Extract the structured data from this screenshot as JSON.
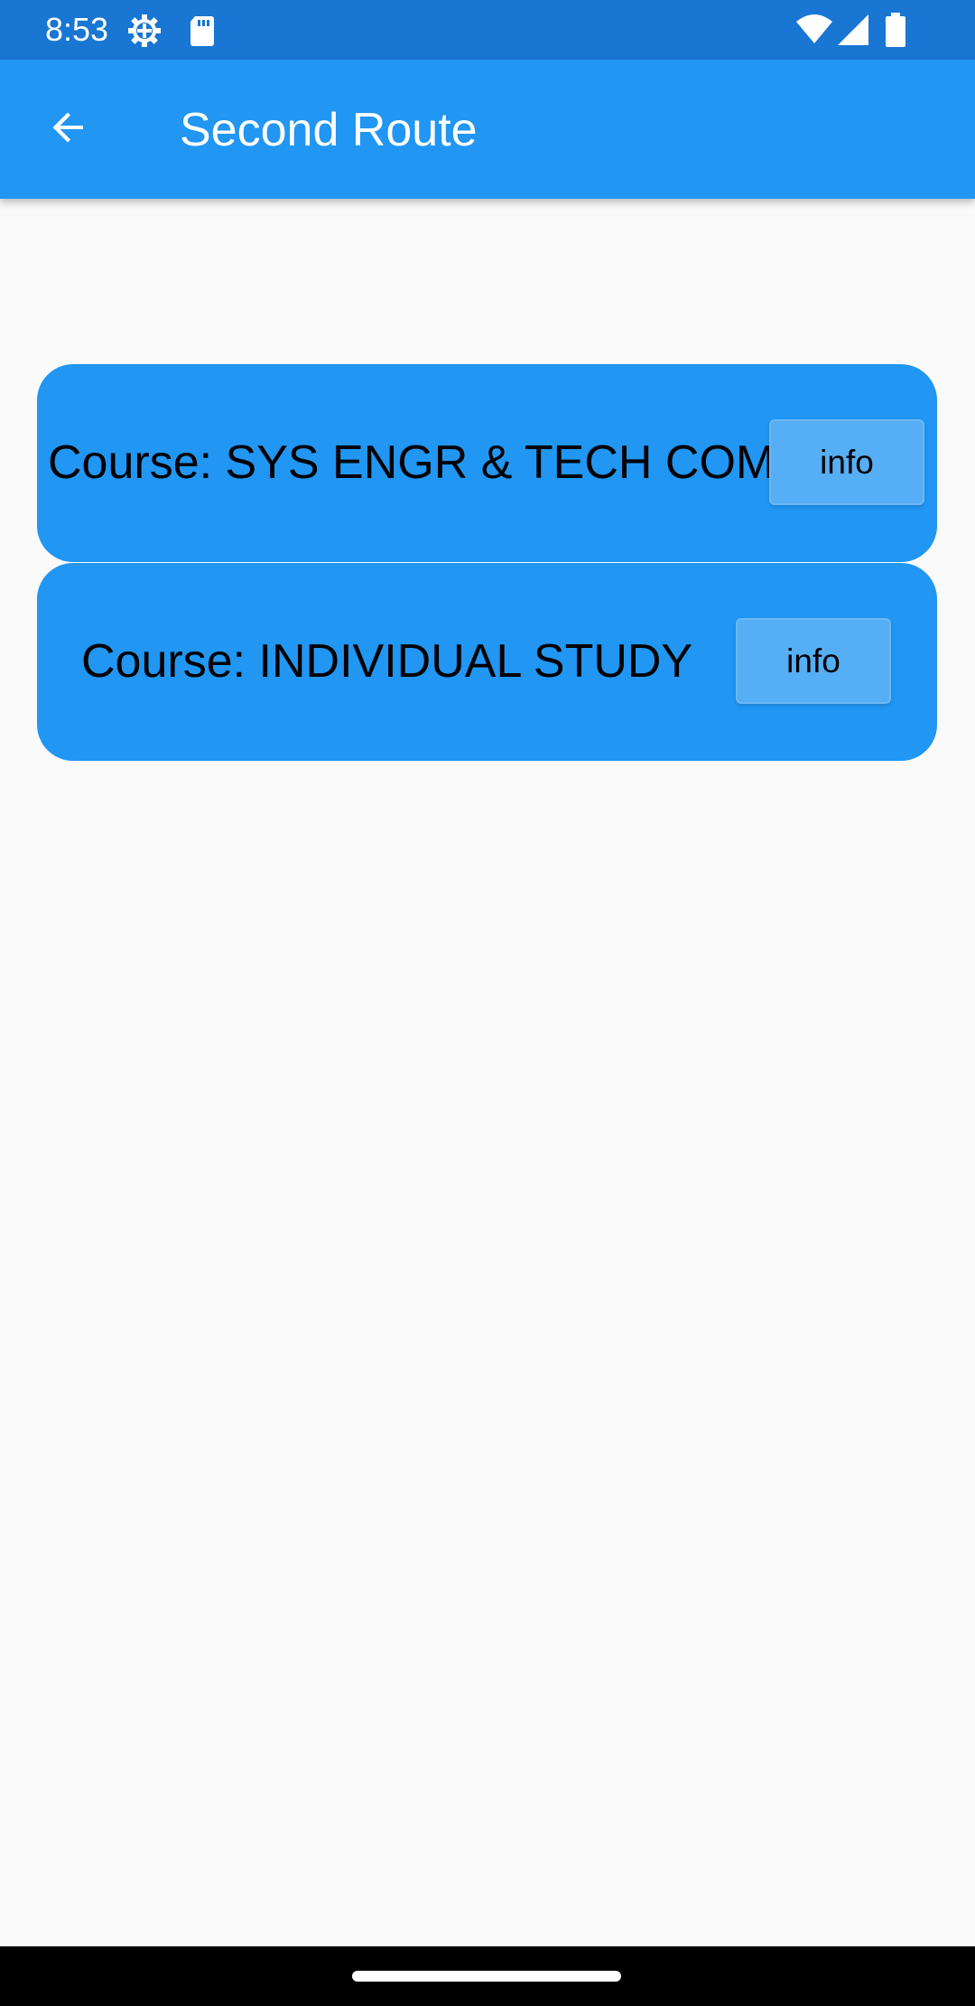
{
  "status_bar": {
    "time": "8:53",
    "icons": [
      "settings-gear-icon",
      "sd-card-icon",
      "wifi-icon",
      "cellular-signal-icon",
      "battery-icon"
    ],
    "background_color": "#1976d2"
  },
  "app_bar": {
    "back_icon": "arrow-back-icon",
    "title": "Second Route",
    "background_color": "#2196f3"
  },
  "courses": [
    {
      "label": "Course: SYS ENGR & TECH COM",
      "button_label": "info"
    },
    {
      "label": "Course: INDIVIDUAL STUDY",
      "button_label": "info"
    }
  ],
  "colors": {
    "card": "#2196f3",
    "button": "#56aef5",
    "background": "#fafafa"
  }
}
